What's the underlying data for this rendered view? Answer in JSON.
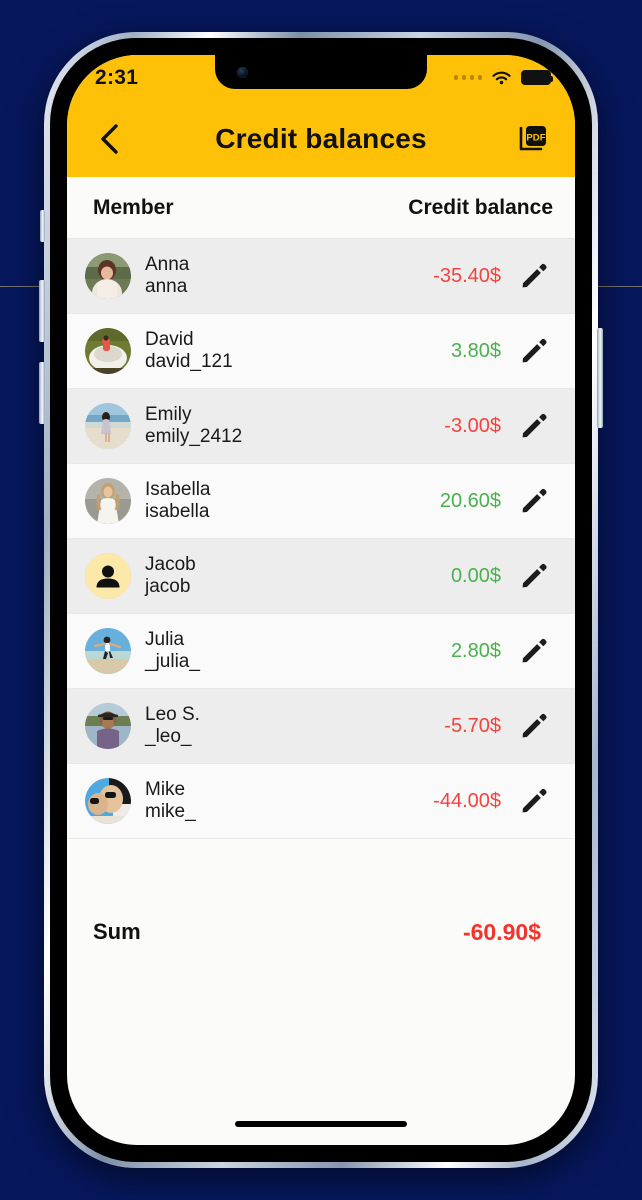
{
  "statusbar": {
    "time": "2:31",
    "cellular_icon": "cellular-dots-icon",
    "wifi_icon": "wifi-icon",
    "battery_icon": "battery-full-icon"
  },
  "navbar": {
    "back_icon": "chevron-left-icon",
    "title": "Credit balances",
    "pdf_icon": "pdf-export-icon",
    "bg_color": "#ffc107"
  },
  "table": {
    "headers": {
      "member": "Member",
      "balance": "Credit balance"
    },
    "edit_icon": "pencil-icon",
    "rows": [
      {
        "name": "Anna",
        "username": "anna",
        "amount": "-35.40$",
        "sign": "neg",
        "avatar": "photo-woman-field"
      },
      {
        "name": "David",
        "username": "david_121",
        "amount": "3.80$",
        "sign": "pos",
        "avatar": "photo-boat-water"
      },
      {
        "name": "Emily",
        "username": "emily_2412",
        "amount": "-3.00$",
        "sign": "neg",
        "avatar": "photo-beach-woman"
      },
      {
        "name": "Isabella",
        "username": "isabella",
        "amount": "20.60$",
        "sign": "pos",
        "avatar": "photo-woman-white-dress"
      },
      {
        "name": "Jacob",
        "username": "jacob",
        "amount": "0.00$",
        "sign": "pos",
        "avatar": "placeholder-person"
      },
      {
        "name": "Julia",
        "username": "_julia_",
        "amount": "2.80$",
        "sign": "pos",
        "avatar": "photo-jumping-beach"
      },
      {
        "name": "Leo S.",
        "username": "_leo_",
        "amount": "-5.70$",
        "sign": "neg",
        "avatar": "photo-man-hat"
      },
      {
        "name": "Mike",
        "username": "mike_",
        "amount": "-44.00$",
        "sign": "neg",
        "avatar": "photo-man-sunglasses"
      }
    ]
  },
  "summary": {
    "label": "Sum",
    "value": "-60.90$"
  },
  "colors": {
    "accent_yellow": "#ffc107",
    "negative": "#f4433e",
    "positive": "#4caf50",
    "sum_negative": "#f4332c",
    "row_odd": "#ededed",
    "row_even": "#fafafa",
    "backdrop": "#06175c"
  }
}
